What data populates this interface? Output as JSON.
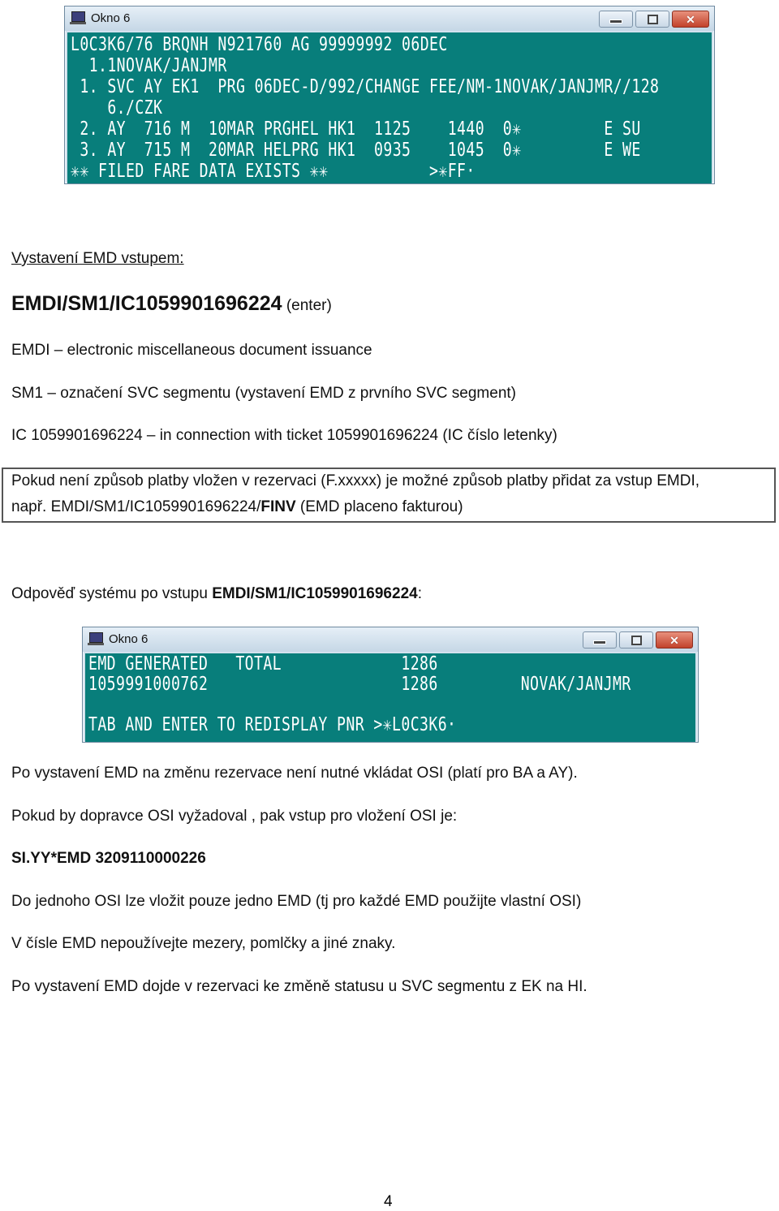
{
  "window1": {
    "title": "Okno 6",
    "lines": [
      "L0C3K6/76 BRQNH N921760 AG 99999992 06DEC",
      "  1.1NOVAK/JANJMR",
      " 1. SVC AY EK1  PRG 06DEC-D/992/CHANGE FEE/NM-1NOVAK/JANJMR//128",
      "    6./CZK",
      " 2. AY  716 M  10MAR PRGHEL HK1  1125    1440  0✳         E SU",
      " 3. AY  715 M  20MAR HELPRG HK1  0935    1045  0✳         E WE",
      "✳✳ FILED FARE DATA EXISTS ✳✳           >✳FF·"
    ]
  },
  "window2": {
    "title": "Okno 6",
    "lines": [
      "EMD GENERATED   TOTAL             1286",
      "1059991000762                     1286         NOVAK/JANJMR",
      "",
      "TAB AND ENTER TO REDISPLAY PNR >✳L0C3K6·"
    ]
  },
  "window_buttons": {
    "minimize": "minimize",
    "maximize": "maximize",
    "close": "✕"
  },
  "doc": {
    "heading": "Vystavení EMD vstupem:",
    "command": "EMDI/SM1/IC1059901696224",
    "command_suffix": " (enter)",
    "def_emdi": "EMDI – electronic miscellaneous document issuance",
    "def_sm1": "SM1 – označení SVC segmentu (vystavení EMD z prvního SVC segment)",
    "def_ic": "IC 1059901696224 – in connection with ticket 1059901696224 (IC číslo letenky)",
    "note_line1": "Pokud není způsob platby vložen v rezervaci (F.xxxxx) je možné způsob platby přidat za vstup EMDI,",
    "note_line2_prefix": "např. EMDI/SM1/IC1059901696224/",
    "note_line2_bold": "FINV",
    "note_line2_suffix": " (EMD placeno fakturou)",
    "response_prefix": "Odpověď systému po vstupu ",
    "response_bold": "EMDI/SM1/IC1059901696224",
    "response_suffix": ":",
    "para_osi1": "Po vystavení EMD na změnu rezervace není nutné vkládat OSI (platí pro BA a AY).",
    "para_osi2": "Pokud by dopravce OSI vyžadoval , pak vstup pro vložení OSI je:",
    "osi_command": "SI.YY*EMD 3209110000226",
    "para_osi3": "Do jednoho OSI lze vložit pouze jedno EMD (tj pro každé EMD použijte vlastní OSI)",
    "para_osi4": "V čísle EMD nepoužívejte mezery, pomlčky a jiné znaky.",
    "para_osi5": "Po vystavení EMD dojde v rezervaci ke změně statusu u SVC segmentu z  EK na HI."
  },
  "page_number": "4"
}
